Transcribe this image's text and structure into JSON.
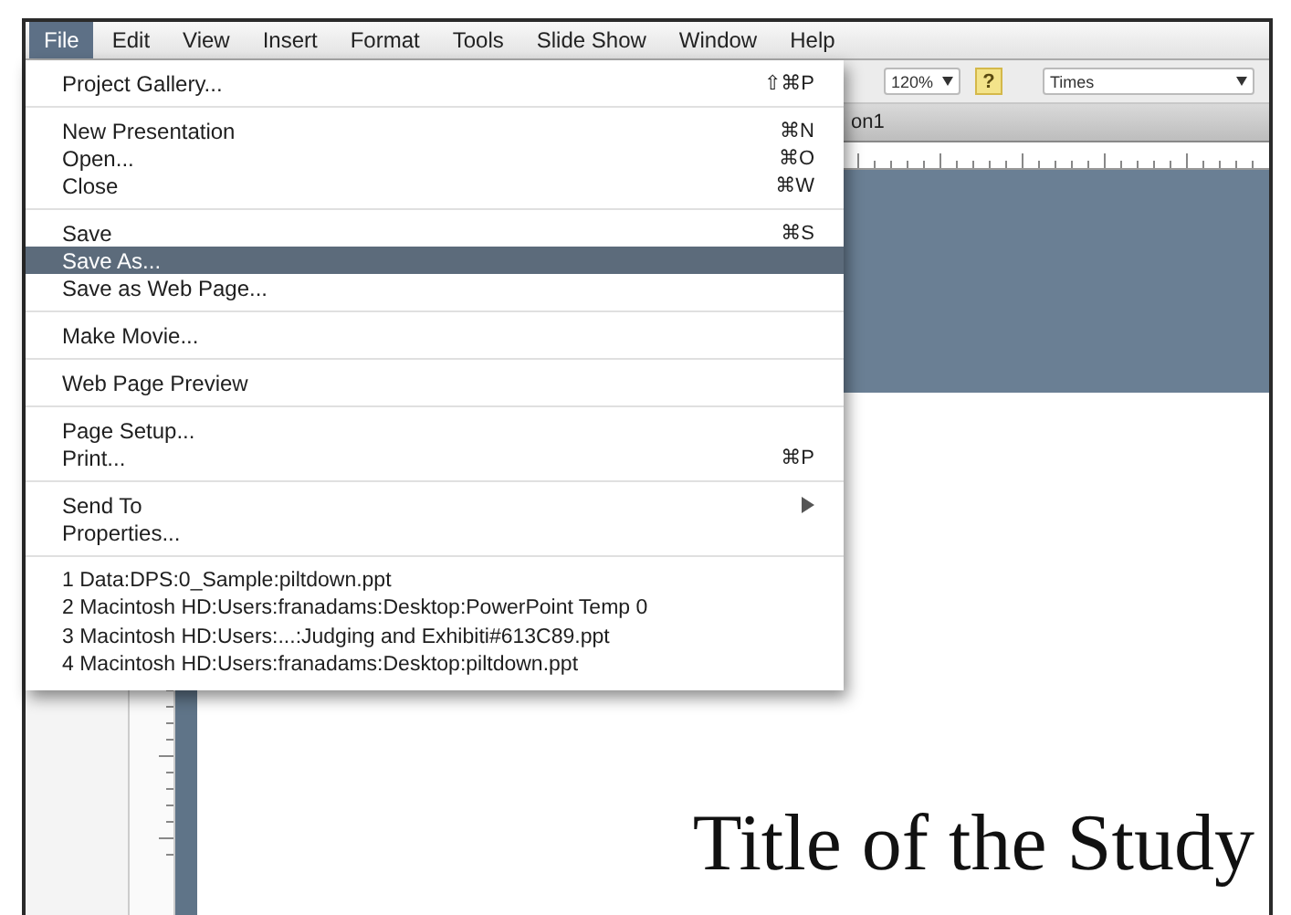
{
  "menu_bar": [
    {
      "label": "File",
      "selected": true
    },
    {
      "label": "Edit",
      "selected": false
    },
    {
      "label": "View",
      "selected": false
    },
    {
      "label": "Insert",
      "selected": false
    },
    {
      "label": "Format",
      "selected": false
    },
    {
      "label": "Tools",
      "selected": false
    },
    {
      "label": "Slide Show",
      "selected": false
    },
    {
      "label": "Window",
      "selected": false
    },
    {
      "label": "Help",
      "selected": false
    }
  ],
  "toolbar": {
    "zoom": "120%",
    "help_glyph": "?",
    "font": "Times"
  },
  "document_tab": {
    "title": "on1"
  },
  "file_menu": [
    [
      {
        "label": "Project Gallery...",
        "shortcut": "⇧⌘P",
        "selected": false
      }
    ],
    [
      {
        "label": "New Presentation",
        "shortcut": "⌘N",
        "selected": false
      },
      {
        "label": "Open...",
        "shortcut": "⌘O",
        "selected": false
      },
      {
        "label": "Close",
        "shortcut": "⌘W",
        "selected": false
      }
    ],
    [
      {
        "label": "Save",
        "shortcut": "⌘S",
        "selected": false
      },
      {
        "label": "Save As...",
        "selected": true
      },
      {
        "label": "Save as Web Page...",
        "selected": false
      }
    ],
    [
      {
        "label": "Make Movie...",
        "selected": false
      }
    ],
    [
      {
        "label": "Web Page Preview",
        "selected": false
      }
    ],
    [
      {
        "label": "Page Setup...",
        "selected": false
      },
      {
        "label": "Print...",
        "shortcut": "⌘P",
        "selected": false
      }
    ],
    [
      {
        "label": "Send To",
        "submenu": true,
        "selected": false
      },
      {
        "label": "Properties...",
        "selected": false
      }
    ],
    [
      {
        "label": "1 Data:DPS:0_Sample:piltdown.ppt",
        "kind": "recent",
        "selected": false
      },
      {
        "label": "2 Macintosh HD:Users:franadams:Desktop:PowerPoint Temp 0",
        "kind": "recent",
        "selected": false
      },
      {
        "label": "3 Macintosh HD:Users:...:Judging and Exhibiti#613C89.ppt",
        "kind": "recent",
        "selected": false
      },
      {
        "label": "4 Macintosh HD:Users:franadams:Desktop:piltdown.ppt",
        "kind": "recent",
        "selected": false
      }
    ]
  ],
  "slide": {
    "title": "Title of the Study"
  }
}
